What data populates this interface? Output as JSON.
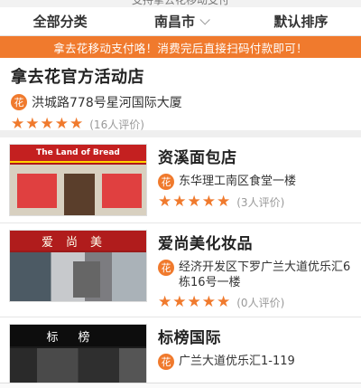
{
  "top_strip": {
    "text": "支持拿去花移动支付"
  },
  "filters": [
    {
      "label": "全部分类"
    },
    {
      "label": "南昌市"
    },
    {
      "label": "默认排序"
    }
  ],
  "notice": "拿去花移动支付咯！消费完后直接扫码付款即可！",
  "featured": {
    "title": "拿去花官方活动店",
    "badge": "花",
    "address": "洪城路778号星河国际大厦",
    "stars": 5,
    "review_count": "(16人评价)"
  },
  "shops": [
    {
      "name": "资溪面包店",
      "badge": "花",
      "address": "东华理工南区食堂一楼",
      "stars": 5,
      "review_count": "(3人评价)",
      "image_sign": [
        "The Land of Bread"
      ]
    },
    {
      "name": "爱尚美化妆品",
      "badge": "花",
      "address": "经济开发区下罗广兰大道优乐汇6栋16号一楼",
      "stars": 5,
      "review_count": "(0人评价)",
      "image_sign": [
        "爱尚美"
      ]
    },
    {
      "name": "标榜国际",
      "badge": "花",
      "address": "广兰大道优乐汇1-119",
      "stars": 5,
      "review_count": "",
      "image_sign": [
        "标榜"
      ]
    }
  ]
}
